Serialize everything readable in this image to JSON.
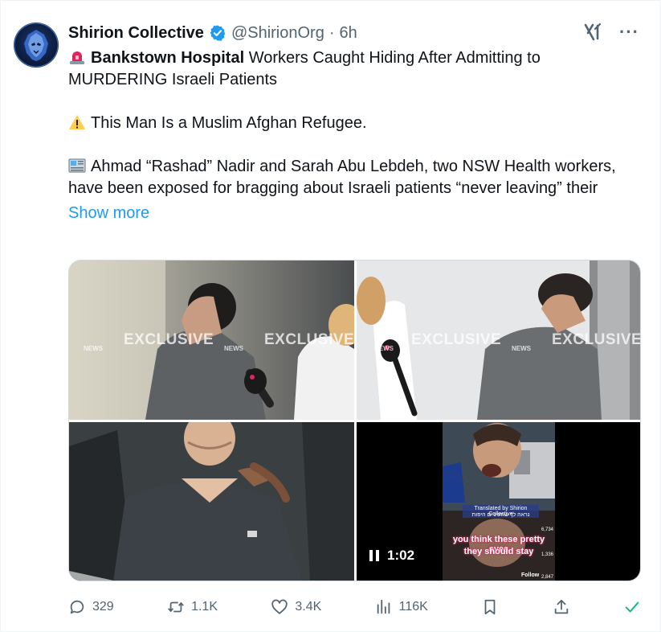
{
  "post": {
    "author_name": "Shirion Collective",
    "handle": "@ShirionOrg",
    "separator": "·",
    "time": "6h",
    "more_label": "···",
    "lines": [
      {
        "emoji": "rotating-light-icon",
        "bold": "Bankstown Hospital",
        "text": " Workers Caught Hiding After Admitting to MURDERING Israeli Patients"
      },
      {
        "emoji": "warning-icon",
        "bold": "",
        "text": "This Man Is a Muslim Afghan Refugee."
      },
      {
        "emoji": "newspaper-icon",
        "bold": "",
        "text": "Ahmad “Rashad” Nadir and Sarah Abu Lebdeh, two NSW Health workers, have been exposed for bragging about Israeli patients “never leaving” their"
      }
    ],
    "show_more": "Show more"
  },
  "media": {
    "watermark_word": "EXCLUSIVE",
    "watermark_brand": "NEWS",
    "video_duration": "1:02",
    "video_caption_1": "you think these pretty eyes",
    "video_caption_2": "they should stay",
    "video_credit": "Translated by Shirion Collective",
    "video_hebrew": "נראה לך שהעיניים היפות",
    "video_follow": "Follow",
    "video_counts": [
      "6,734",
      "1,336",
      "2,847"
    ]
  },
  "actions": {
    "replies": "329",
    "reposts": "1.1K",
    "likes": "3.4K",
    "views": "116K"
  },
  "colors": {
    "accent": "#1d9bf0",
    "verified": "#1d9bf0",
    "muted": "#536471",
    "text": "#0f1419",
    "green_check": "#00ba7c"
  }
}
